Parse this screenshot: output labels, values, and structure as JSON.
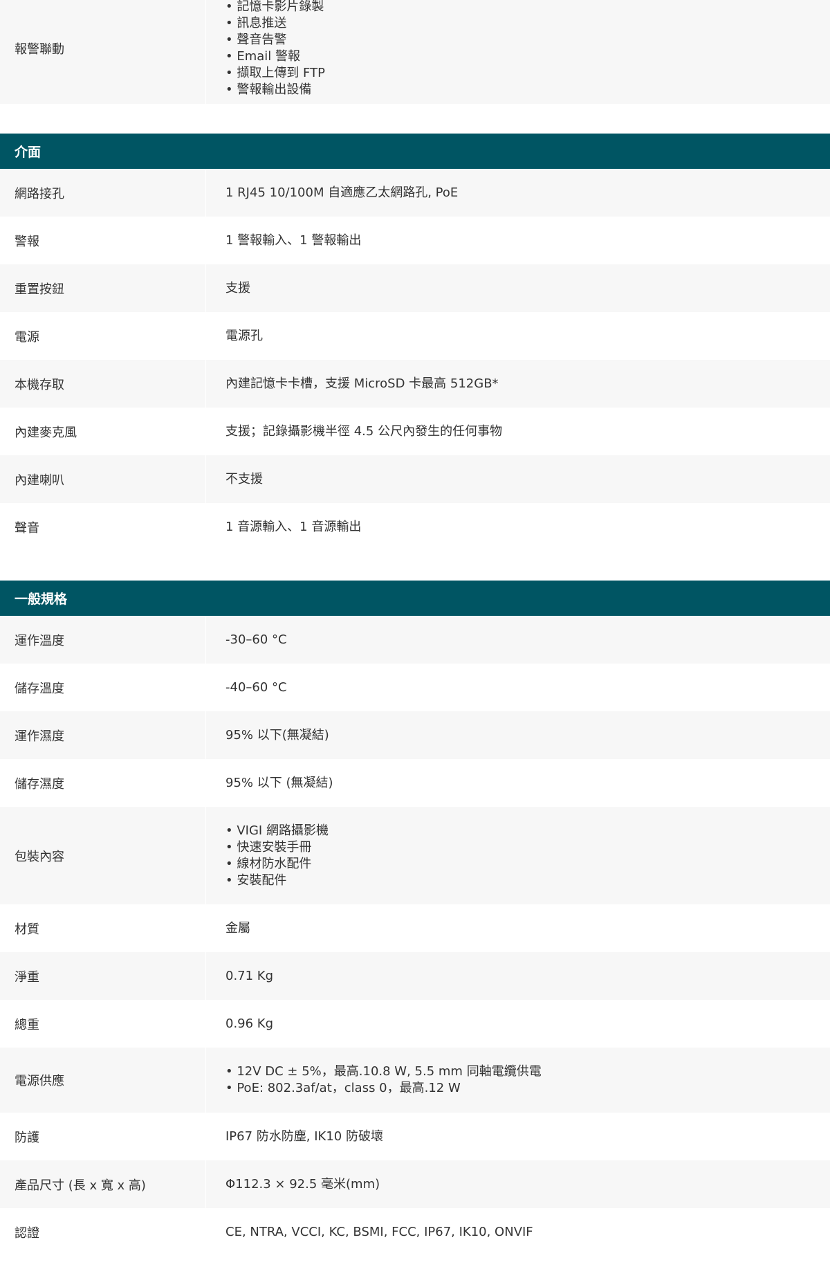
{
  "top_row": {
    "label": "報警聯動",
    "values": [
      "• 記憶卡影片錄製",
      "• 訊息推送",
      "• 聲音告警",
      "• Email 警報",
      "• 擷取上傳到 FTP",
      "• 警報輸出設備"
    ]
  },
  "interface": {
    "title": "介面",
    "rows": [
      {
        "label": "網路接孔",
        "value": "1 RJ45 10/100M 自適應乙太網路孔, PoE"
      },
      {
        "label": "警報",
        "value": "1 警報輸入、1 警報輸出"
      },
      {
        "label": "重置按鈕",
        "value": "支援"
      },
      {
        "label": "電源",
        "value": "電源孔"
      },
      {
        "label": "本機存取",
        "value": "內建記憶卡卡槽，支援 MicroSD 卡最高 512GB*"
      },
      {
        "label": "內建麥克風",
        "value": "支援；記錄攝影機半徑 4.5 公尺內發生的任何事物"
      },
      {
        "label": "內建喇叭",
        "value": "不支援"
      },
      {
        "label": "聲音",
        "value": "1 音源輸入、1 音源輸出"
      }
    ]
  },
  "general": {
    "title": "一般規格",
    "rows": [
      {
        "label": "運作溫度",
        "value": "-30–60 °C"
      },
      {
        "label": "儲存溫度",
        "value": "-40–60 °C"
      },
      {
        "label": "運作濕度",
        "value": "95% 以下(無凝結)"
      },
      {
        "label": "儲存濕度",
        "value": "95% 以下 (無凝結)"
      },
      {
        "label": "包裝內容",
        "values": [
          "• VIGI 網路攝影機",
          "• 快速安裝手冊",
          "• 線材防水配件",
          "• 安裝配件"
        ]
      },
      {
        "label": "材質",
        "value": "金屬"
      },
      {
        "label": "淨重",
        "value": "0.71 Kg"
      },
      {
        "label": "總重",
        "value": "0.96 Kg"
      },
      {
        "label": "電源供應",
        "values": [
          "• 12V DC ± 5%，最高.10.8 W, 5.5 mm 同軸電纜供電",
          "• PoE: 802.3af/at，class 0，最高.12 W"
        ]
      },
      {
        "label": "防護",
        "value": "IP67 防水防塵, IK10 防破壞"
      },
      {
        "label": "產品尺寸 (長 x 寬 x 高)",
        "value": "Φ112.3 × 92.5 毫米(mm)"
      },
      {
        "label": "認證",
        "value": "CE, NTRA, VCCI, KC, BSMI, FCC, IP67, IK10, ONVIF"
      }
    ]
  },
  "colors": {
    "header_bg": "#005563",
    "header_text": "#ffffff",
    "row_alt_bg": "#f7f7f7",
    "text": "#333333"
  }
}
